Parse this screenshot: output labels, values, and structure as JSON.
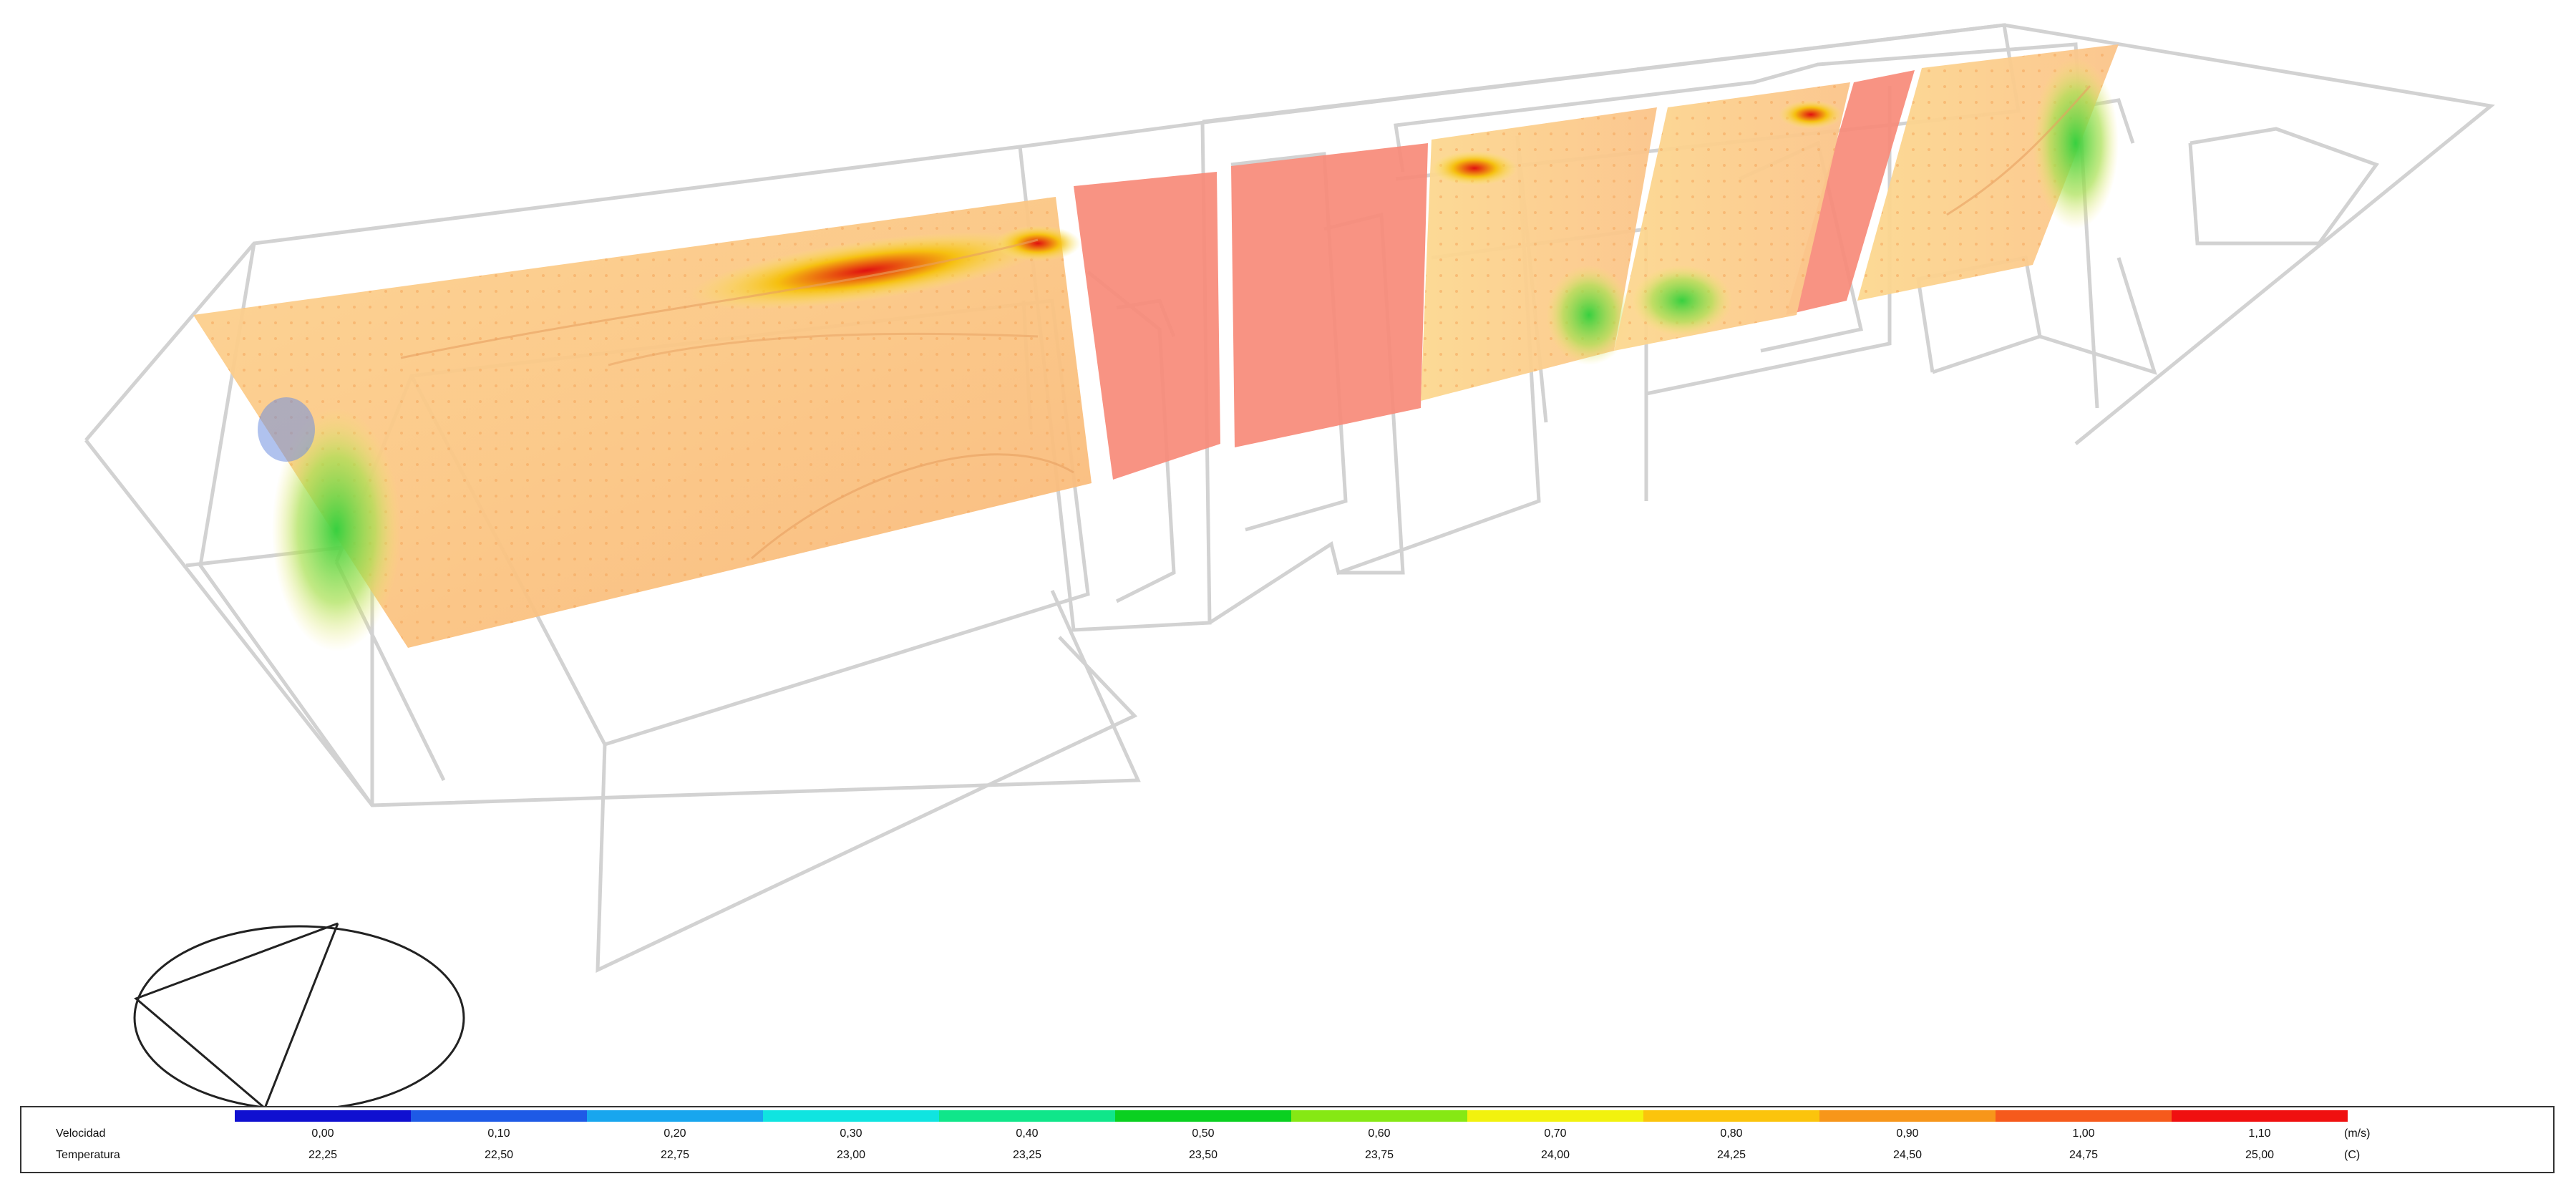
{
  "legend": {
    "velocity_label": "Velocidad",
    "temperature_label": "Temperatura",
    "velocity_unit": "(m/s)",
    "temperature_unit": "(C)",
    "colors": [
      "#1010d0",
      "#1e5ae6",
      "#18a6ee",
      "#10e4e0",
      "#10e68a",
      "#0ad020",
      "#86e814",
      "#f2f20e",
      "#fbc40c",
      "#f7961a",
      "#f65a1c",
      "#f01010"
    ],
    "velocity_ticks": [
      "0,00",
      "0,10",
      "0,20",
      "0,30",
      "0,40",
      "0,50",
      "0,60",
      "0,70",
      "0,80",
      "0,90",
      "1,00",
      "1,10"
    ],
    "temperature_ticks": [
      "22,25",
      "22,50",
      "22,75",
      "23,00",
      "23,25",
      "23,50",
      "23,75",
      "24,00",
      "24,25",
      "24,50",
      "24,75",
      "25,00"
    ]
  },
  "scene": {
    "wireframe_color": "#d2d2d2",
    "plane_base_color": "#fbc98a",
    "plane_warm_color": "#f78a78"
  }
}
